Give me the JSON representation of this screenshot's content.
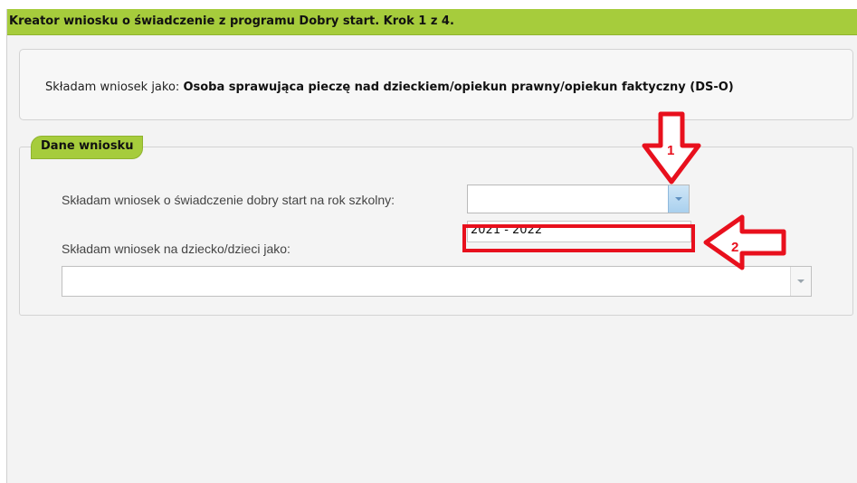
{
  "wizard": {
    "title": "Kreator wniosku o świadczenie z programu Dobry start. Krok 1 z 4."
  },
  "applicant": {
    "label": "Składam wniosek jako: ",
    "value": "Osoba sprawująca pieczę nad dzieckiem/opiekun prawny/opiekun faktyczny (DS-O)"
  },
  "form": {
    "legend": "Dane wniosku",
    "school_year_label": "Składam wniosek o świadczenie dobry start na rok szkolny:",
    "school_year_value": "",
    "school_year_options": [
      "2021 - 2022"
    ],
    "child_label": "Składam wniosek na dziecko/dzieci jako:",
    "child_value": ""
  },
  "annotations": {
    "marker_1": "1",
    "marker_2": "2",
    "color": "#e8101d"
  },
  "colors": {
    "header_green": "#a6cc3c",
    "panel_bg": "#f3f3f3"
  }
}
